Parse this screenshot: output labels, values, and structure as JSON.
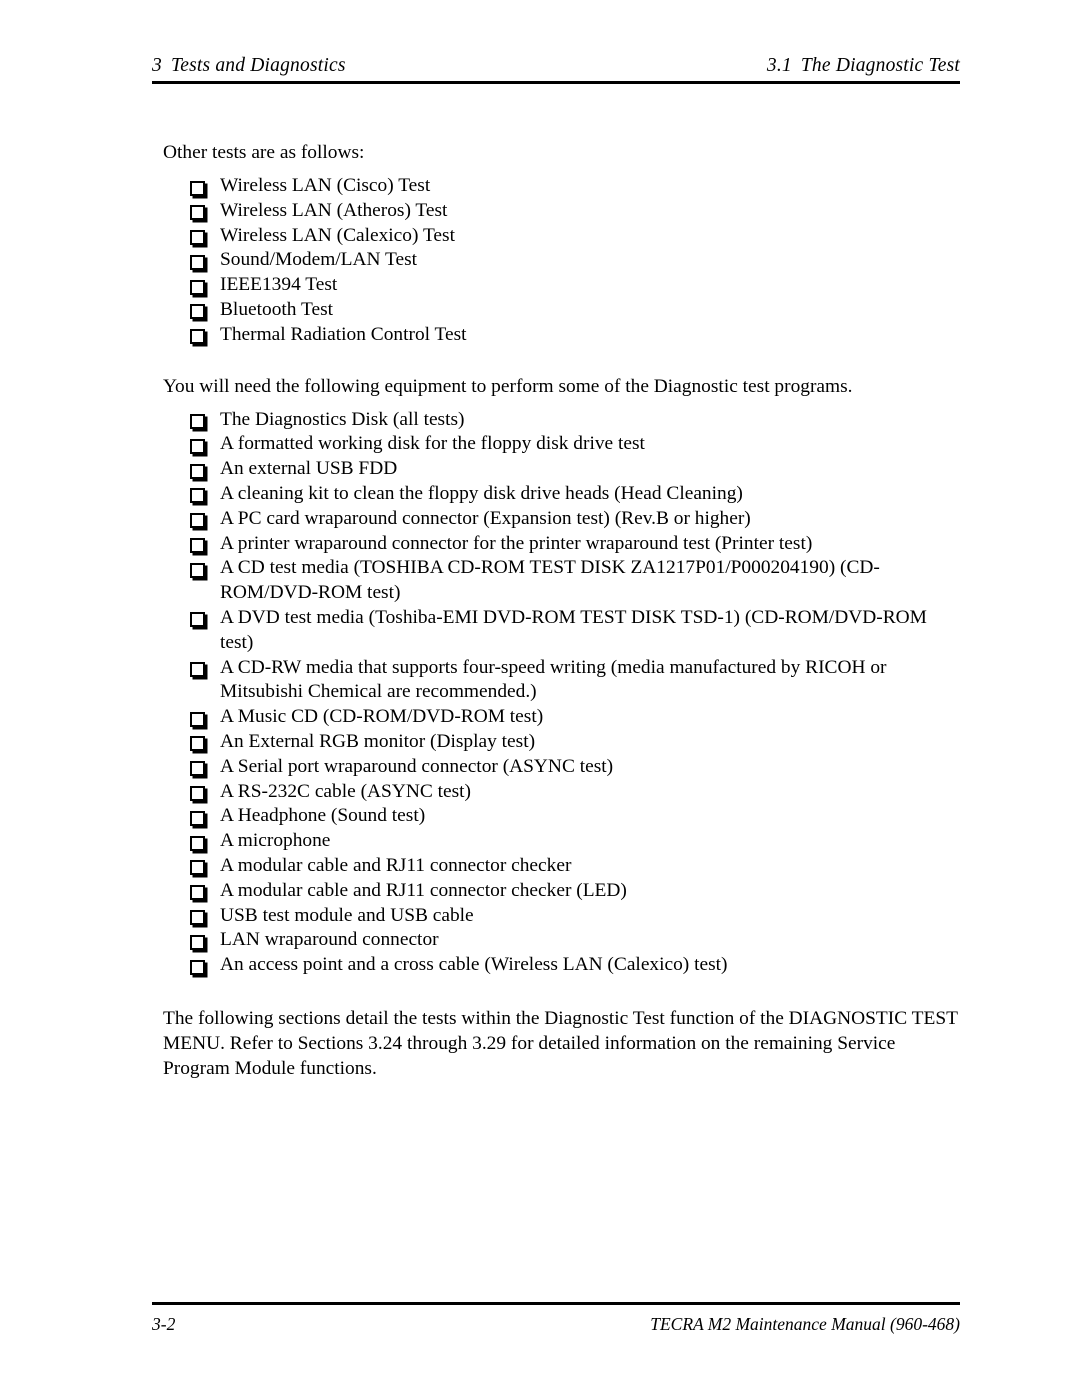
{
  "header": {
    "left_number": "3",
    "left_title": "Tests and Diagnostics",
    "right_number": "3.1",
    "right_title": "The Diagnostic Test"
  },
  "body": {
    "intro_other_tests": "Other tests are as follows:",
    "other_tests": [
      "Wireless LAN (Cisco) Test",
      "Wireless LAN (Atheros) Test",
      "Wireless LAN (Calexico) Test",
      "Sound/Modem/LAN Test",
      "IEEE1394 Test",
      "Bluetooth Test",
      "Thermal Radiation Control Test"
    ],
    "intro_equipment": "You will need the following equipment to perform some of the Diagnostic test programs.",
    "equipment": [
      "The Diagnostics Disk (all tests)",
      "A formatted working disk for the floppy disk drive test",
      "An external USB FDD",
      "A cleaning kit to clean the floppy disk drive heads (Head Cleaning)",
      "A PC card wraparound connector (Expansion test) (Rev.B or higher)",
      "A printer wraparound connector for the printer wraparound test (Printer test)",
      "A CD test media (TOSHIBA CD-ROM TEST DISK ZA1217P01/P000204190) (CD-ROM/DVD-ROM test)",
      "A DVD test media (Toshiba-EMI DVD-ROM TEST DISK TSD-1) (CD-ROM/DVD-ROM test)",
      "A CD-RW media that supports four-speed writing (media manufactured by RICOH or Mitsubishi Chemical are recommended.)",
      "A Music CD (CD-ROM/DVD-ROM test)",
      "An External RGB monitor (Display test)",
      "A Serial port wraparound connector (ASYNC test)",
      "A RS-232C cable (ASYNC test)",
      "A Headphone (Sound test)",
      "A microphone",
      "A modular cable and RJ11 connector checker",
      "A modular cable and RJ11 connector checker (LED)",
      "USB test module and USB cable",
      "LAN wraparound connector",
      "An access point and a cross cable (Wireless LAN (Calexico) test)"
    ],
    "closing_paragraph": "The following sections detail the tests within the Diagnostic Test function of the DIAGNOSTIC TEST MENU. Refer to Sections 3.24 through 3.29 for detailed information on the remaining Service Program Module functions."
  },
  "footer": {
    "page_number": "3-2",
    "manual_title": "TECRA M2 Maintenance Manual (960-468)"
  }
}
